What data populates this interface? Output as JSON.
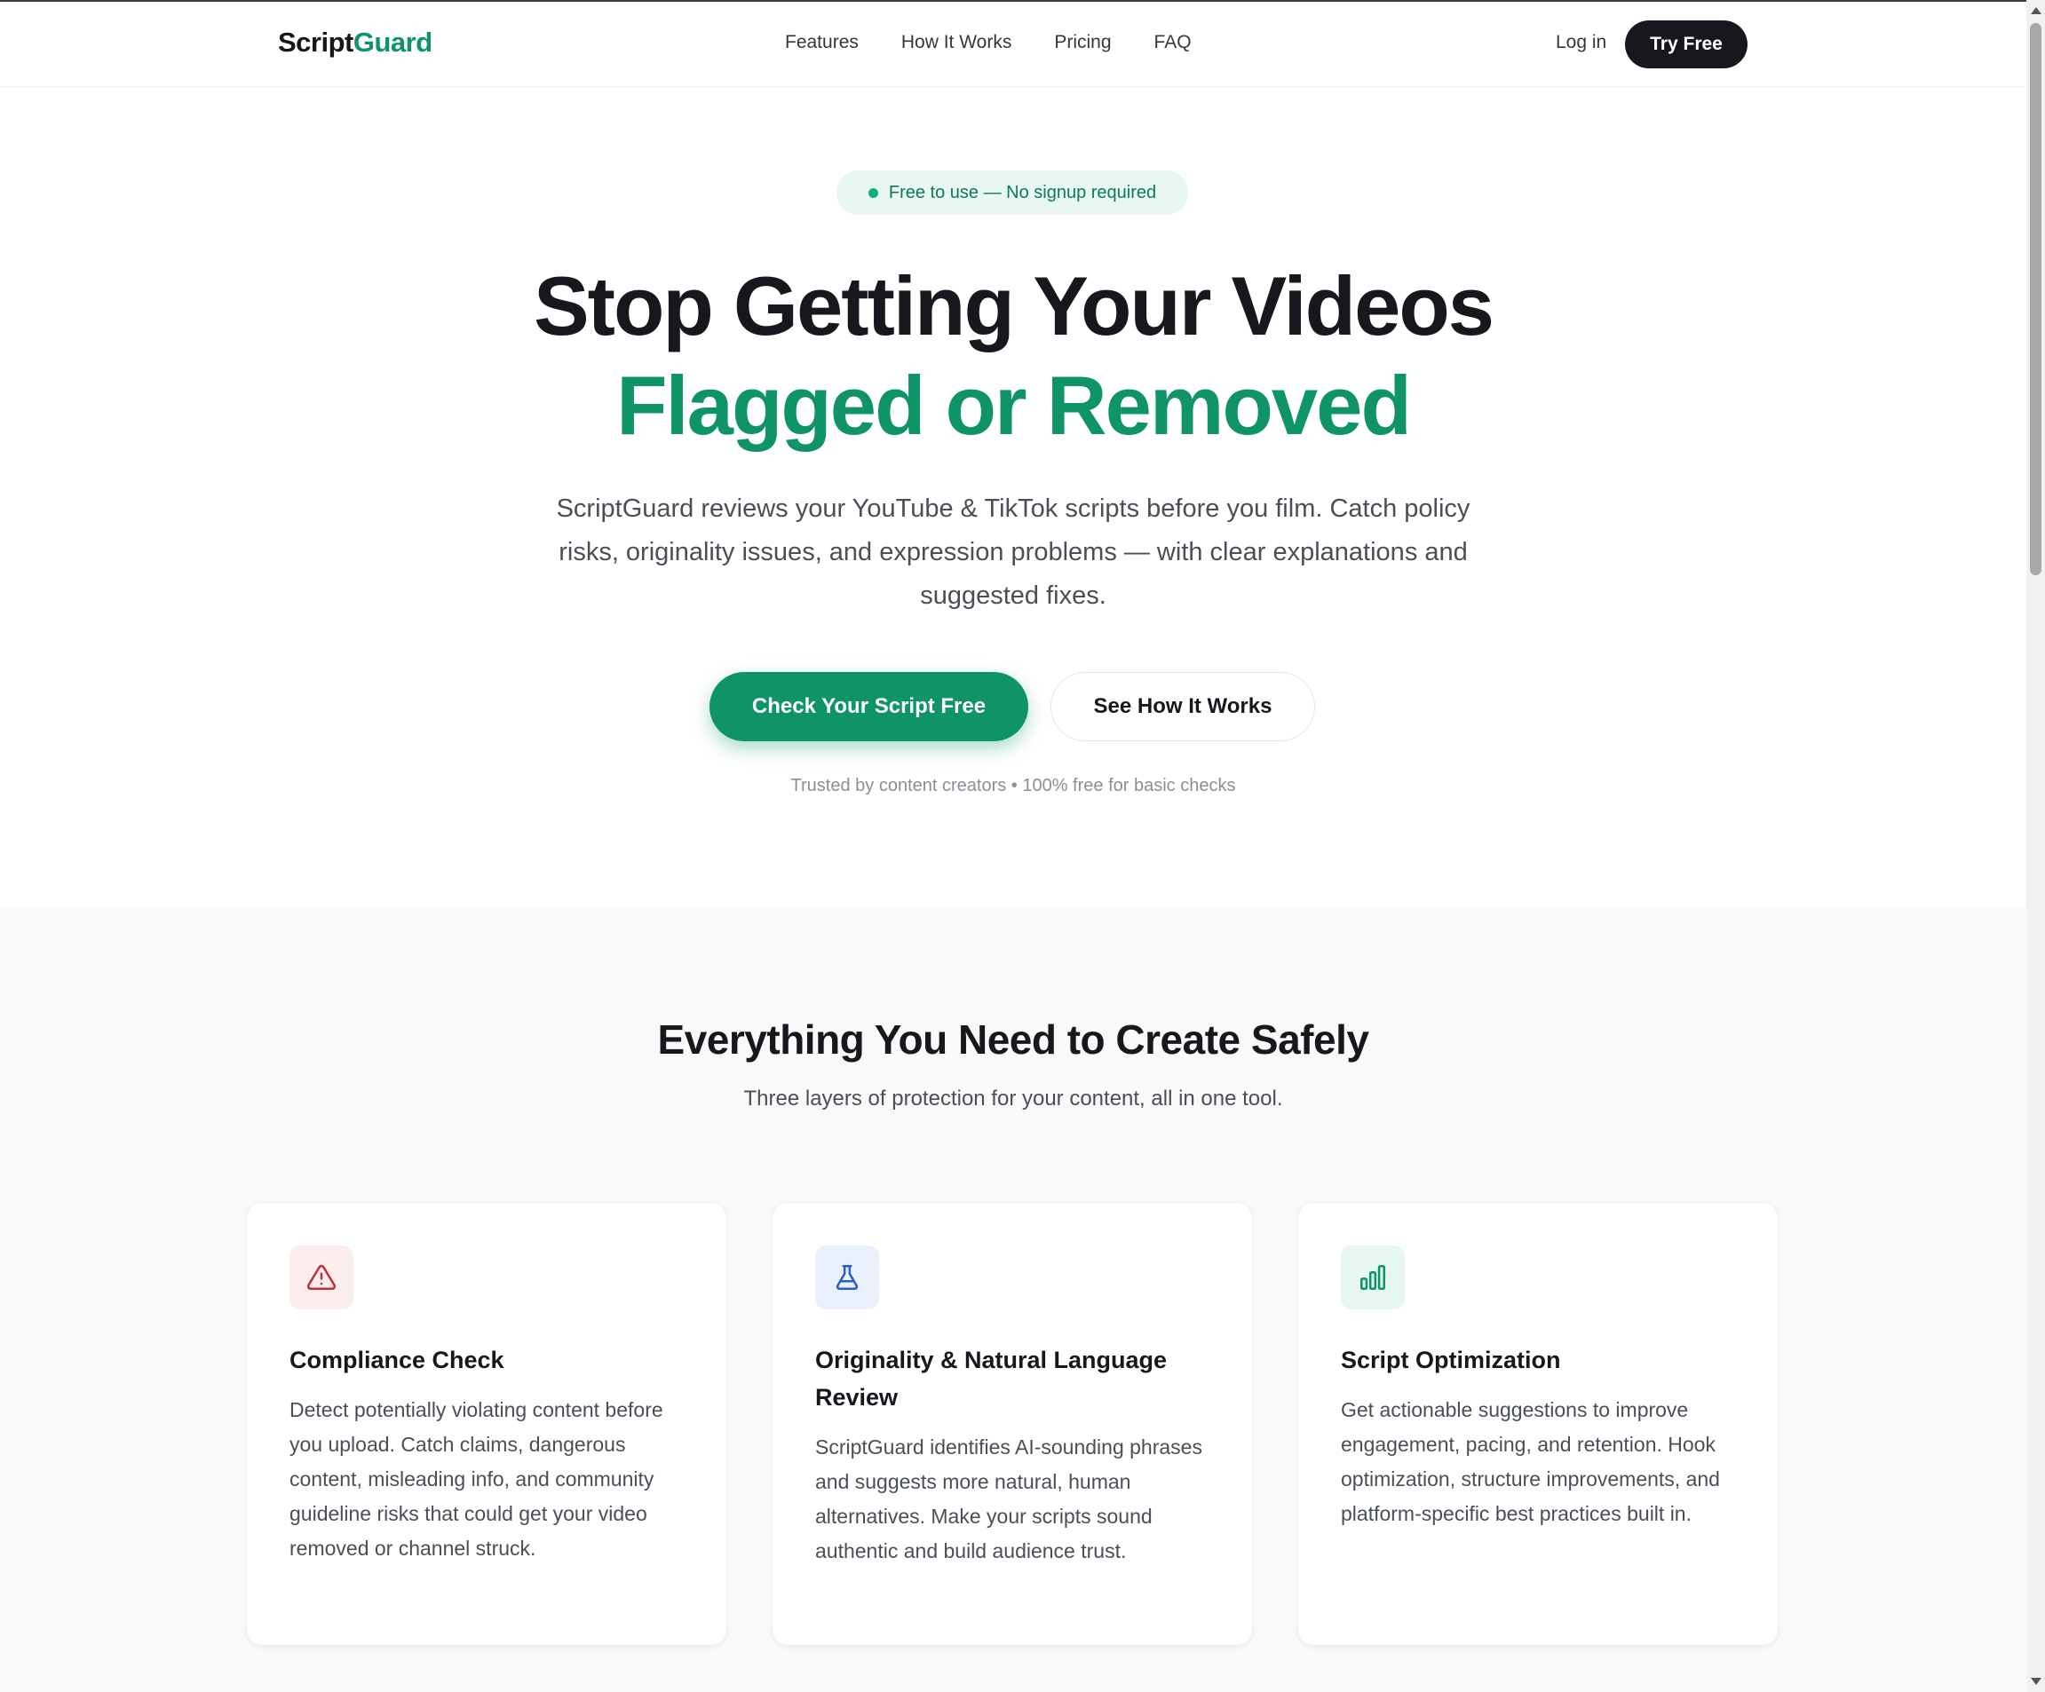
{
  "nav": {
    "logo_part1": "Script",
    "logo_part2": "Guard",
    "links": [
      "Features",
      "How It Works",
      "Pricing",
      "FAQ"
    ],
    "login": "Log in",
    "try_free": "Try Free"
  },
  "hero": {
    "badge": "Free to use — No signup required",
    "headline_line1": "Stop Getting Your Videos",
    "headline_line2": "Flagged or Removed",
    "subtitle": "ScriptGuard reviews your YouTube & TikTok scripts before you film. Catch policy risks, originality issues, and expression problems — with clear explanations and suggested fixes.",
    "primary_cta": "Check Your Script Free",
    "secondary_cta": "See How It Works",
    "trusted": "Trusted by content creators • 100% free for basic checks"
  },
  "features": {
    "title": "Everything You Need to Create Safely",
    "subtitle": "Three layers of protection for your content, all in one tool.",
    "cards": [
      {
        "icon": "warning-triangle-icon",
        "title": "Compliance Check",
        "description": "Detect potentially violating content before you upload. Catch claims, dangerous content, misleading info, and community guideline risks that could get your video removed or channel struck."
      },
      {
        "icon": "flask-icon",
        "title": "Originality & Natural Language Review",
        "description": "ScriptGuard identifies AI-sounding phrases and suggests more natural, human alternatives. Make your scripts sound authentic and build audience trust."
      },
      {
        "icon": "bar-chart-icon",
        "title": "Script Optimization",
        "description": "Get actionable suggestions to improve engagement, pacing, and retention. Hook optimization, structure improvements, and platform-specific best practices built in."
      }
    ]
  },
  "colors": {
    "brand_green": "#0f9466",
    "dark": "#16181d",
    "warning_red": "#c0303a",
    "flask_blue": "#2a5fc4"
  }
}
